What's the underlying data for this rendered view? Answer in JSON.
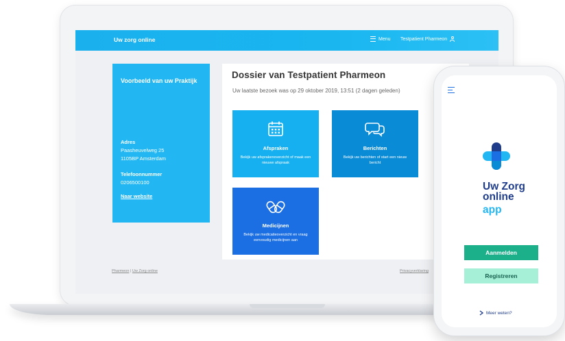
{
  "laptop": {
    "topbar": {
      "brand": "Uw zorg online",
      "menu_label": "Menu",
      "user_name": "Testpatient Pharmeon"
    },
    "practice": {
      "title": "Voorbeeld van uw Praktijk",
      "address_label": "Adres",
      "address_line1": "Paasheuvelweg 25",
      "address_line2": "1105BP Amsterdam",
      "phone_label": "Telefoonnummer",
      "phone": "0206500100",
      "website_link": "Naar website"
    },
    "dossier": {
      "title": "Dossier van Testpatient Pharmeon",
      "last_visit": "Uw laatste bezoek was op 29 oktober 2019, 13:51 (2 dagen geleden)",
      "tiles": [
        {
          "title": "Afspraken",
          "description": "Bekijk uw afsprakenoverzicht of maak een nieuwe afspraak",
          "icon": "calendar-icon"
        },
        {
          "title": "Berichten",
          "description": "Bekijk uw berichten of start een nieuw bericht",
          "icon": "chat-bubbles-icon"
        },
        {
          "title": "Medicijnen",
          "description": "Bekijk uw medicatieoverzicht en vraag eenvoudig medicijnen aan",
          "icon": "pills-icon"
        }
      ]
    },
    "footer": {
      "pharmeon": "Pharmeon",
      "separator": "|",
      "uwzorg": "Uw Zorg online",
      "privacy": "Privacyverklaring"
    }
  },
  "phone": {
    "menu_icon": "hamburger-icon",
    "logo_icon": "medical-cross-logo",
    "title_line1": "Uw Zorg",
    "title_line2": "online",
    "title_line3": "app",
    "login_button": "Aanmelden",
    "register_button": "Registreren",
    "more_link": "Meer weten?"
  },
  "colors": {
    "topbar": "#19b6f0",
    "practice_panel": "#22b7f2",
    "tile_afspraken": "#16b0f0",
    "tile_berichten": "#0a8bd6",
    "tile_medicijnen": "#1b6fe3",
    "app_title": "#1f3d8a",
    "login_button": "#1bb08a",
    "register_button": "#a6f0d8"
  }
}
